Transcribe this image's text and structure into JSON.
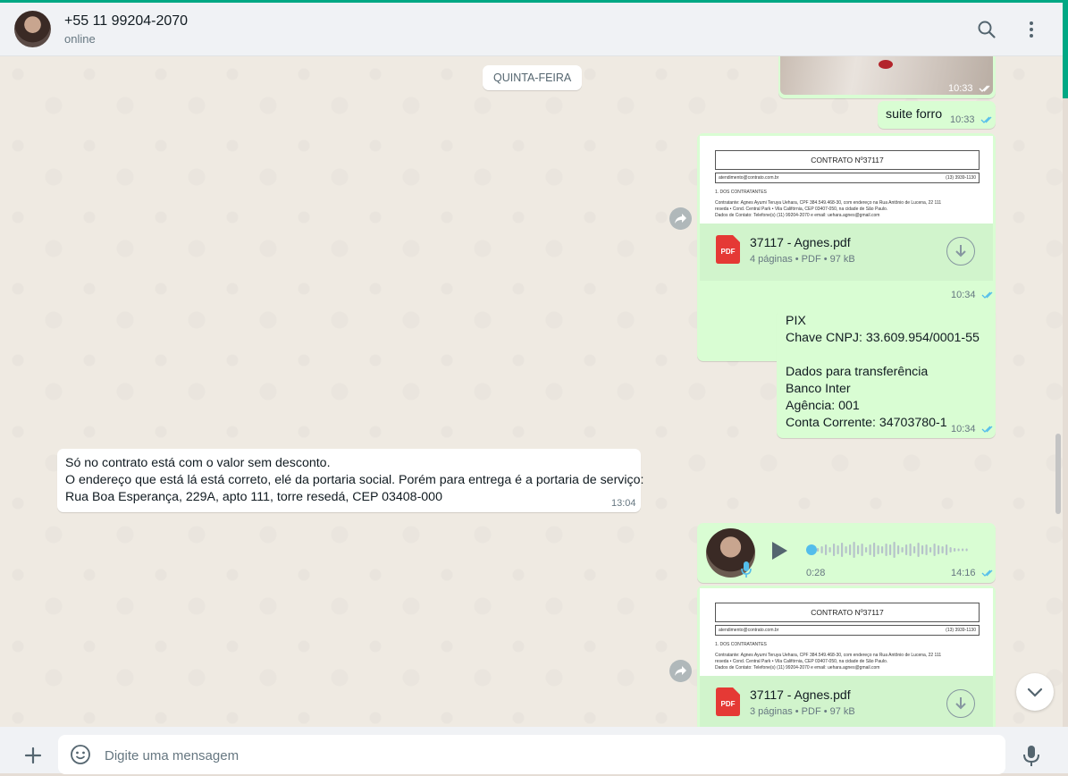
{
  "header": {
    "contact_name": "+55 11 99204-2070",
    "status": "online",
    "search_icon": "search-icon",
    "menu_icon": "menu-dots-icon"
  },
  "chat": {
    "date_chip": "QUINTA-FEIRA",
    "image_msg": {
      "time": "10:33"
    },
    "text_msg_1": {
      "text": "suite forro",
      "time": "10:33"
    },
    "doc_msg_1": {
      "preview_title": "CONTRATO Nº37117",
      "preview_email": "atendimento@contrato.com.br",
      "preview_phone": "(13) 3939-1130",
      "preview_section": "1. DOS CONTRATANTES",
      "preview_line1": "Contratante: Agnes Ayumi Teruya Uehara, CPF 384.549.468-30, com endereço na Rua Antônio de Lucena, 22 111",
      "preview_line2": "reseda • Cond. Central Park • Vila Califórnia, CEP 03407-050, na cidade de São Paulo.",
      "preview_line3": "Dados de Contato: Telefone(s) (11) 99204-2070 e email: uehara.agnes@gmail.com",
      "file_name": "37117 - Agnes.pdf",
      "file_meta": "4 páginas • PDF • 97 kB",
      "time": "10:34"
    },
    "pix_msg": {
      "lines": [
        "PIX",
        "Chave CNPJ: 33.609.954/0001-55",
        "",
        "Dados para transferência",
        "Banco Inter",
        "Agência: 001",
        "Conta Corrente: 34703780-1"
      ],
      "time": "10:34"
    },
    "incoming_msg": {
      "lines": [
        "Só no contrato está com o valor sem desconto.",
        "O endereço que está lá está correto, elé da portaria social. Porém para entrega é a portaria de serviço:",
        "Rua Boa Esperança, 229A, apto 111, torre resedá, CEP 03408-000"
      ],
      "time": "13:04"
    },
    "voice_msg": {
      "duration": "0:28",
      "time": "14:16",
      "progress": 0
    },
    "doc_msg_2": {
      "preview_title": "CONTRATO Nº37117",
      "preview_email": "atendimento@contrato.com.br",
      "preview_phone": "(13) 3939-1130",
      "preview_section": "1. DOS CONTRATANTES",
      "preview_line1": "Contratante: Agnes Ayumi Teruya Uehara, CPF 384.549.468-30, com endereço na Rua Antônio de Lucena, 22 111",
      "preview_line2": "reseda • Cond. Central Park • Vila Califórnia, CEP 03407-050, na cidade de São Paulo.",
      "preview_line3": "Dados de Contato: Telefone(s) (11) 99204-2070 e email: uehara.agnes@gmail.com",
      "file_name": "37117 - Agnes.pdf",
      "file_meta": "3 páginas • PDF • 97 kB"
    }
  },
  "composer": {
    "placeholder": "Digite uma mensagem",
    "value": ""
  },
  "colors": {
    "accent": "#00a884",
    "outgoing_bubble": "#d9fdd3",
    "read_ticks": "#53bdeb",
    "pdf_red": "#e53935"
  }
}
